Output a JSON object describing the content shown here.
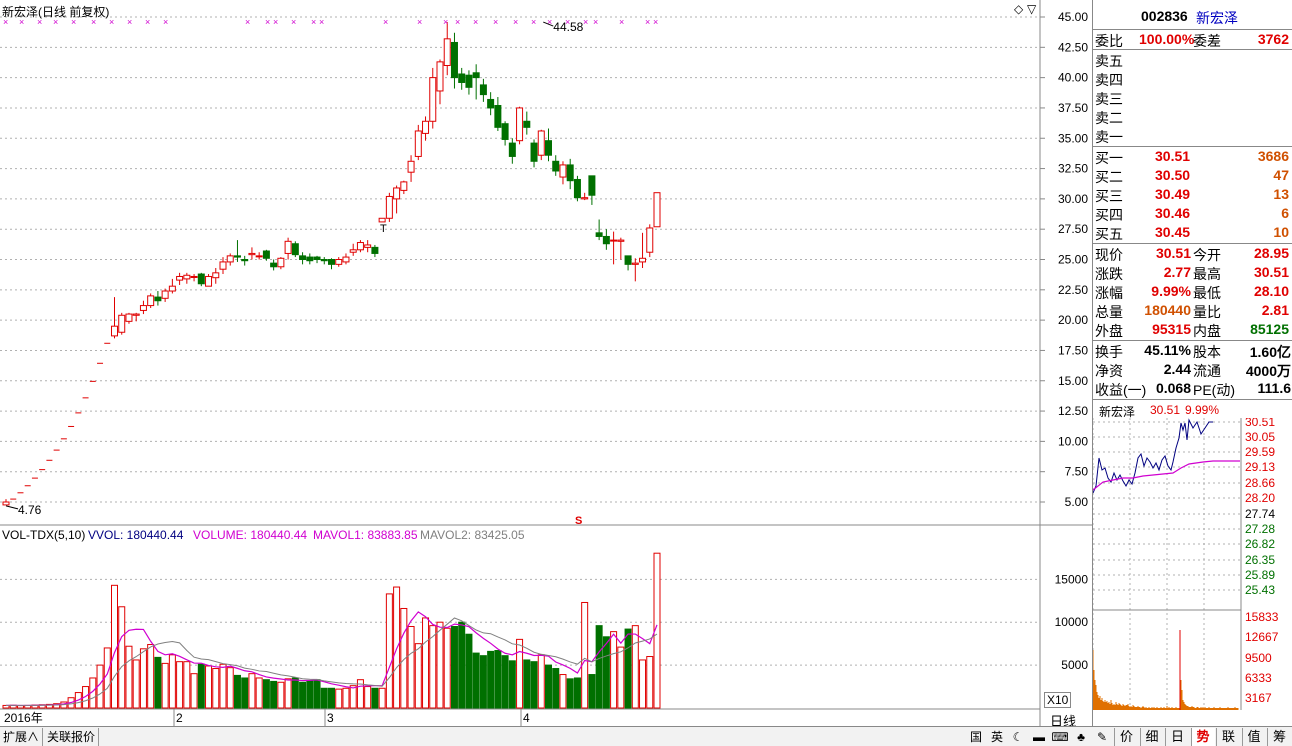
{
  "header": {
    "stock_title": "新宏泽(日线 前复权)",
    "high_marker": "44.58",
    "low_marker": "4.76",
    "s_marker": "S"
  },
  "price_axis": [
    "45.00",
    "42.50",
    "40.00",
    "37.50",
    "35.00",
    "32.50",
    "30.00",
    "27.50",
    "25.00",
    "22.50",
    "20.00",
    "17.50",
    "15.00",
    "12.50",
    "10.00",
    "7.50",
    "5.00"
  ],
  "vol_header": {
    "name": "VOL-TDX(5,10)",
    "vvol_label": "VVOL: 180440.44",
    "volume_label": "VOLUME: 180440.44",
    "mavol1_label": "MAVOL1: 83883.85",
    "mavol2_label": "MAVOL2: 83425.05"
  },
  "vol_axis": [
    "15000",
    "10000",
    "5000"
  ],
  "vol_unit": "X10",
  "date_axis": {
    "year": "2016年",
    "months": [
      "2",
      "3",
      "4"
    ]
  },
  "period_label": "日线",
  "chart_data": {
    "type": "candlestick",
    "price_range": [
      4.0,
      45.5
    ],
    "volume_range": [
      0,
      19000
    ],
    "candles": [
      [
        4.76,
        5.0,
        5.24,
        4.76,
        300
      ],
      [
        5.24,
        5.24,
        5.24,
        5.24,
        320
      ],
      [
        5.76,
        5.76,
        5.76,
        5.76,
        280
      ],
      [
        6.34,
        6.34,
        6.34,
        6.34,
        300
      ],
      [
        6.97,
        6.97,
        6.97,
        6.97,
        350
      ],
      [
        7.67,
        7.67,
        7.67,
        7.67,
        380
      ],
      [
        8.44,
        8.44,
        8.44,
        8.44,
        420
      ],
      [
        9.28,
        9.28,
        9.28,
        9.28,
        500
      ],
      [
        10.21,
        10.21,
        10.21,
        10.21,
        700
      ],
      [
        11.23,
        11.23,
        11.23,
        11.23,
        1200
      ],
      [
        12.35,
        12.35,
        12.35,
        12.35,
        1800
      ],
      [
        13.59,
        13.59,
        13.59,
        13.59,
        2500
      ],
      [
        14.95,
        14.95,
        14.95,
        14.95,
        3500
      ],
      [
        16.44,
        16.44,
        16.44,
        16.44,
        5000
      ],
      [
        18.09,
        18.09,
        18.09,
        18.09,
        7000
      ],
      [
        18.7,
        19.5,
        21.9,
        18.5,
        14300
      ],
      [
        19.0,
        20.4,
        20.6,
        18.8,
        11800
      ],
      [
        19.9,
        20.5,
        20.6,
        19.7,
        7200
      ],
      [
        20.4,
        20.5,
        20.6,
        19.9,
        5600
      ],
      [
        20.8,
        21.2,
        21.6,
        20.5,
        6900
      ],
      [
        21.2,
        22.0,
        22.2,
        21.0,
        7400
      ],
      [
        21.9,
        21.6,
        22.4,
        21.2,
        5900
      ],
      [
        21.8,
        22.4,
        22.6,
        21.5,
        5200
      ],
      [
        22.4,
        22.8,
        23.4,
        22.2,
        6200
      ],
      [
        23.3,
        23.6,
        23.9,
        22.9,
        5400
      ],
      [
        23.4,
        23.7,
        23.9,
        23.0,
        5400
      ],
      [
        23.6,
        23.6,
        23.8,
        23.2,
        4000
      ],
      [
        23.8,
        23.0,
        23.9,
        22.8,
        5100
      ],
      [
        22.8,
        23.6,
        23.8,
        22.8,
        4900
      ],
      [
        23.5,
        23.9,
        24.3,
        23.0,
        4600
      ],
      [
        24.2,
        24.8,
        25.2,
        23.8,
        5100
      ],
      [
        24.8,
        25.3,
        25.5,
        24.5,
        4700
      ],
      [
        25.3,
        25.2,
        26.6,
        24.8,
        3800
      ],
      [
        25.0,
        24.9,
        25.3,
        24.5,
        3500
      ],
      [
        25.4,
        25.5,
        26.0,
        25.0,
        4000
      ],
      [
        25.3,
        25.3,
        25.6,
        25.0,
        3500
      ],
      [
        25.7,
        25.1,
        25.8,
        24.9,
        3300
      ],
      [
        24.7,
        24.4,
        25.0,
        24.1,
        3100
      ],
      [
        24.4,
        25.1,
        25.2,
        24.2,
        3000
      ],
      [
        25.5,
        26.5,
        26.8,
        25.0,
        3400
      ],
      [
        26.3,
        25.4,
        26.5,
        25.2,
        3500
      ],
      [
        25.3,
        25.0,
        25.6,
        24.6,
        3000
      ],
      [
        25.2,
        24.9,
        25.5,
        24.6,
        3200
      ],
      [
        25.2,
        25.0,
        25.3,
        24.7,
        3300
      ],
      [
        25.0,
        24.9,
        25.2,
        24.6,
        2300
      ],
      [
        25.0,
        24.6,
        25.1,
        24.2,
        2300
      ],
      [
        24.6,
        25.0,
        25.2,
        24.4,
        2200
      ],
      [
        24.8,
        25.2,
        25.5,
        24.6,
        2300
      ],
      [
        25.6,
        25.8,
        26.3,
        25.3,
        2600
      ],
      [
        25.8,
        26.4,
        26.6,
        25.6,
        3300
      ],
      [
        26.0,
        26.2,
        26.6,
        25.6,
        2500
      ],
      [
        26.0,
        25.5,
        26.2,
        25.2,
        2300
      ],
      [
        28.1,
        28.4,
        28.4,
        28.1,
        2300
      ],
      [
        28.4,
        30.2,
        30.5,
        28.1,
        13300
      ],
      [
        30.0,
        30.9,
        31.1,
        28.8,
        14100
      ],
      [
        30.7,
        31.4,
        31.5,
        30.4,
        11600
      ],
      [
        32.2,
        33.1,
        33.6,
        31.4,
        9500
      ],
      [
        33.5,
        35.6,
        36.1,
        33.2,
        7500
      ],
      [
        35.4,
        36.4,
        36.8,
        34.8,
        10500
      ],
      [
        36.4,
        40.0,
        40.8,
        35.8,
        9600
      ],
      [
        38.9,
        41.3,
        41.5,
        37.8,
        10000
      ],
      [
        41.0,
        43.2,
        44.58,
        40.2,
        9300
      ],
      [
        42.9,
        40.0,
        43.7,
        39.1,
        9500
      ],
      [
        40.3,
        39.6,
        40.8,
        39.0,
        10000
      ],
      [
        40.2,
        39.2,
        40.6,
        38.6,
        8600
      ],
      [
        40.4,
        40.0,
        41.1,
        38.2,
        6400
      ],
      [
        39.4,
        38.6,
        39.9,
        38.0,
        6100
      ],
      [
        38.2,
        37.5,
        38.8,
        36.9,
        6600
      ],
      [
        37.7,
        35.9,
        38.4,
        35.6,
        6700
      ],
      [
        36.2,
        34.9,
        36.4,
        34.4,
        6100
      ],
      [
        34.6,
        33.5,
        35.0,
        32.9,
        5500
      ],
      [
        34.8,
        37.5,
        37.6,
        34.5,
        8000
      ],
      [
        36.4,
        35.9,
        37.2,
        35.3,
        5600
      ],
      [
        34.6,
        33.1,
        34.9,
        32.6,
        5400
      ],
      [
        33.6,
        35.6,
        35.7,
        33.2,
        6200
      ],
      [
        34.8,
        33.6,
        35.8,
        33.1,
        5000
      ],
      [
        33.1,
        32.3,
        33.6,
        31.9,
        4600
      ],
      [
        31.8,
        32.8,
        33.1,
        31.2,
        3900
      ],
      [
        32.8,
        31.5,
        33.3,
        30.8,
        3400
      ],
      [
        31.6,
        30.1,
        31.9,
        29.8,
        3500
      ],
      [
        30.0,
        30.1,
        30.5,
        29.9,
        12300
      ],
      [
        31.9,
        30.3,
        31.9,
        29.5,
        3900
      ],
      [
        27.2,
        26.9,
        28.3,
        26.6,
        9600
      ],
      [
        26.9,
        26.3,
        27.5,
        25.8,
        8300
      ],
      [
        26.6,
        26.6,
        27.3,
        24.6,
        8900
      ],
      [
        26.5,
        26.6,
        26.8,
        25.0,
        7100
      ],
      [
        25.3,
        24.6,
        25.3,
        24.1,
        9200
      ],
      [
        24.6,
        24.7,
        25.1,
        23.2,
        9600
      ],
      [
        24.8,
        25.1,
        27.2,
        24.3,
        5600
      ],
      [
        25.6,
        27.6,
        27.9,
        25.2,
        6000
      ],
      [
        27.7,
        30.51,
        30.51,
        28.1,
        18044
      ]
    ]
  },
  "quote": {
    "code": "002836",
    "name": "新宏泽",
    "weibi_label": "委比",
    "weibi_value": "100.00%",
    "weicha_label": "委差",
    "weicha_value": "3762",
    "sell": [
      {
        "label": "卖五",
        "price": "",
        "vol": ""
      },
      {
        "label": "卖四",
        "price": "",
        "vol": ""
      },
      {
        "label": "卖三",
        "price": "",
        "vol": ""
      },
      {
        "label": "卖二",
        "price": "",
        "vol": ""
      },
      {
        "label": "卖一",
        "price": "",
        "vol": ""
      }
    ],
    "buy": [
      {
        "label": "买一",
        "price": "30.51",
        "vol": "3686"
      },
      {
        "label": "买二",
        "price": "30.50",
        "vol": "47"
      },
      {
        "label": "买三",
        "price": "30.49",
        "vol": "13"
      },
      {
        "label": "买四",
        "price": "30.46",
        "vol": "6"
      },
      {
        "label": "买五",
        "price": "30.45",
        "vol": "10"
      }
    ],
    "stats1": [
      {
        "l1": "现价",
        "v1": "30.51",
        "c1": "red",
        "l2": "今开",
        "v2": "28.95",
        "c2": "red"
      },
      {
        "l1": "涨跌",
        "v1": "2.77",
        "c1": "red",
        "l2": "最高",
        "v2": "30.51",
        "c2": "red"
      },
      {
        "l1": "涨幅",
        "v1": "9.99%",
        "c1": "red",
        "l2": "最低",
        "v2": "28.10",
        "c2": "red"
      },
      {
        "l1": "总量",
        "v1": "180440",
        "c1": "orange",
        "l2": "量比",
        "v2": "2.81",
        "c2": "red"
      },
      {
        "l1": "外盘",
        "v1": "95315",
        "c1": "red",
        "l2": "内盘",
        "v2": "85125",
        "c2": "green"
      }
    ],
    "stats2": [
      {
        "l1": "换手",
        "v1": "45.11%",
        "l2": "股本",
        "v2": "1.60亿"
      },
      {
        "l1": "净资",
        "v1": "2.44",
        "l2": "流通",
        "v2": "4000万"
      },
      {
        "l1": "收益(一)",
        "v1": "0.068",
        "l2": "PE(动)",
        "v2": "111.6"
      }
    ]
  },
  "mini_chart": {
    "name": "新宏泽",
    "price": "30.51",
    "pct": "9.99%",
    "price_axis": [
      "30.51",
      "30.05",
      "29.59",
      "29.13",
      "28.66",
      "28.20",
      "27.74",
      "27.28",
      "26.82",
      "26.35",
      "25.89",
      "25.43"
    ],
    "vol_axis": [
      "15833",
      "12667",
      "9500",
      "6333",
      "3167"
    ]
  },
  "bottom_tabs": [
    "扩展∧",
    "关联报价"
  ],
  "bottom_icons": [
    {
      "name": "country-flag-icon",
      "glyph": "国"
    },
    {
      "name": "english-icon",
      "glyph": "英"
    },
    {
      "name": "moon-icon",
      "glyph": "☾"
    },
    {
      "name": "gamepad-icon",
      "glyph": "▬"
    },
    {
      "name": "keyboard-icon",
      "glyph": "⌨"
    },
    {
      "name": "shirt-icon",
      "glyph": "♣"
    },
    {
      "name": "wrench-icon",
      "glyph": "✎"
    }
  ],
  "right_tabs": [
    "价",
    "细",
    "日",
    "势",
    "联",
    "值",
    "筹"
  ],
  "right_active_tab": "势",
  "colors": {
    "up": "#e00000",
    "down": "#007000",
    "ma1": "#d000d0",
    "ma2": "#808080",
    "grid": "#b0b0b0"
  }
}
